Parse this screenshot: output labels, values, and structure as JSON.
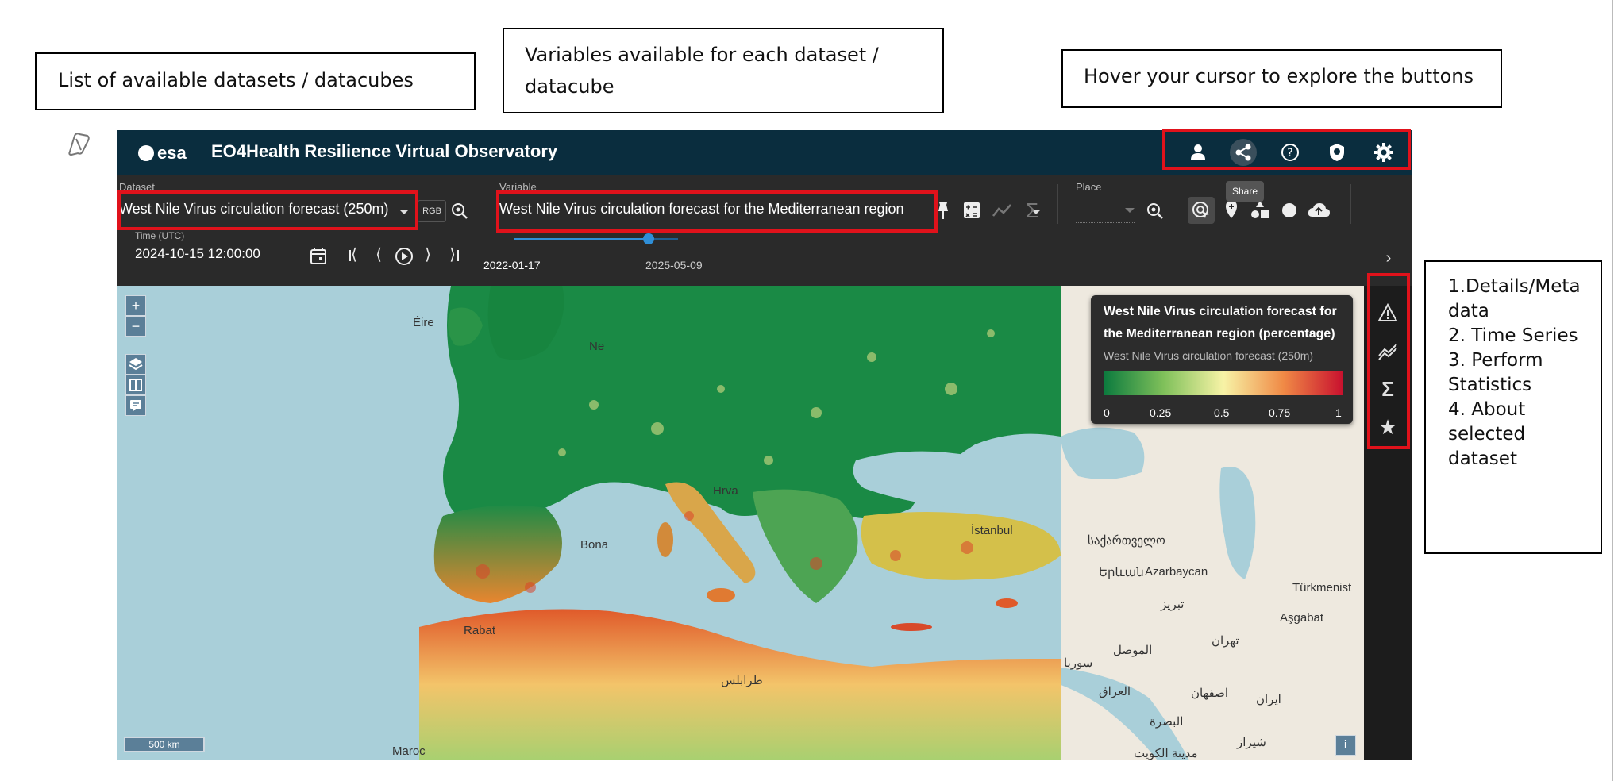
{
  "callouts": {
    "datasets": "List of available datasets / datacubes",
    "variables_line1": "Variables available for each dataset /",
    "variables_line2": "datacube",
    "hover": "Hover your cursor to explore the buttons",
    "side": [
      "1.Details/Meta",
      "data",
      "2. Time Series",
      "3. Perform",
      "Statistics",
      "4. About",
      "selected",
      "dataset"
    ]
  },
  "header": {
    "logo_text": "esa",
    "title": "EO4Health Resilience Virtual Observatory",
    "icons": [
      "person-icon",
      "share-icon",
      "help-icon",
      "shield-icon",
      "gear-icon"
    ],
    "tooltip": "Share"
  },
  "toolbar": {
    "dataset_label": "Dataset",
    "dataset_value": "West Nile Virus circulation forecast (250m)",
    "rgb_label": "RGB",
    "variable_label": "Variable",
    "variable_value": "West Nile Virus circulation forecast for the Mediterranean region",
    "place_label": "Place",
    "time_label": "Time (UTC)",
    "time_value": "2024-10-15 12:00:00",
    "slider_start": "2022-01-17",
    "slider_end": "2025-05-09",
    "slider_position": 0.82
  },
  "legend": {
    "title_line1": "West Nile Virus circulation forecast for",
    "title_line2": "the Mediterranean region (percentage)",
    "subtitle": "West Nile Virus circulation forecast (250m)",
    "ticks": [
      "0",
      "0.25",
      "0.5",
      "0.75",
      "1"
    ],
    "colors": [
      "#0b7a3e",
      "#7fc05a",
      "#f7f3a6",
      "#f08a46",
      "#c8102e"
    ]
  },
  "map": {
    "zoom_in": "+",
    "zoom_out": "−",
    "scale": "500 km",
    "info": "i",
    "place_labels": [
      "Éire",
      "Ne",
      "Hrva",
      "Bona",
      "Rabat",
      "طرابلس",
      "İstanbul",
      "საქართველო",
      "Երևան",
      "Azarbaycan",
      "Türkmenist",
      "Aşgabat",
      "الموصل",
      "تهران",
      "العراق",
      "اصفهان",
      "ایران",
      "البصرة",
      "شیراز",
      "مدينة الكويت",
      "تبریز",
      "سوريا",
      "Maroc"
    ]
  },
  "accent_colors": {
    "red_box": "#e0121b",
    "header_bg": "#0a2d3e",
    "slider": "#2f8fd8"
  }
}
